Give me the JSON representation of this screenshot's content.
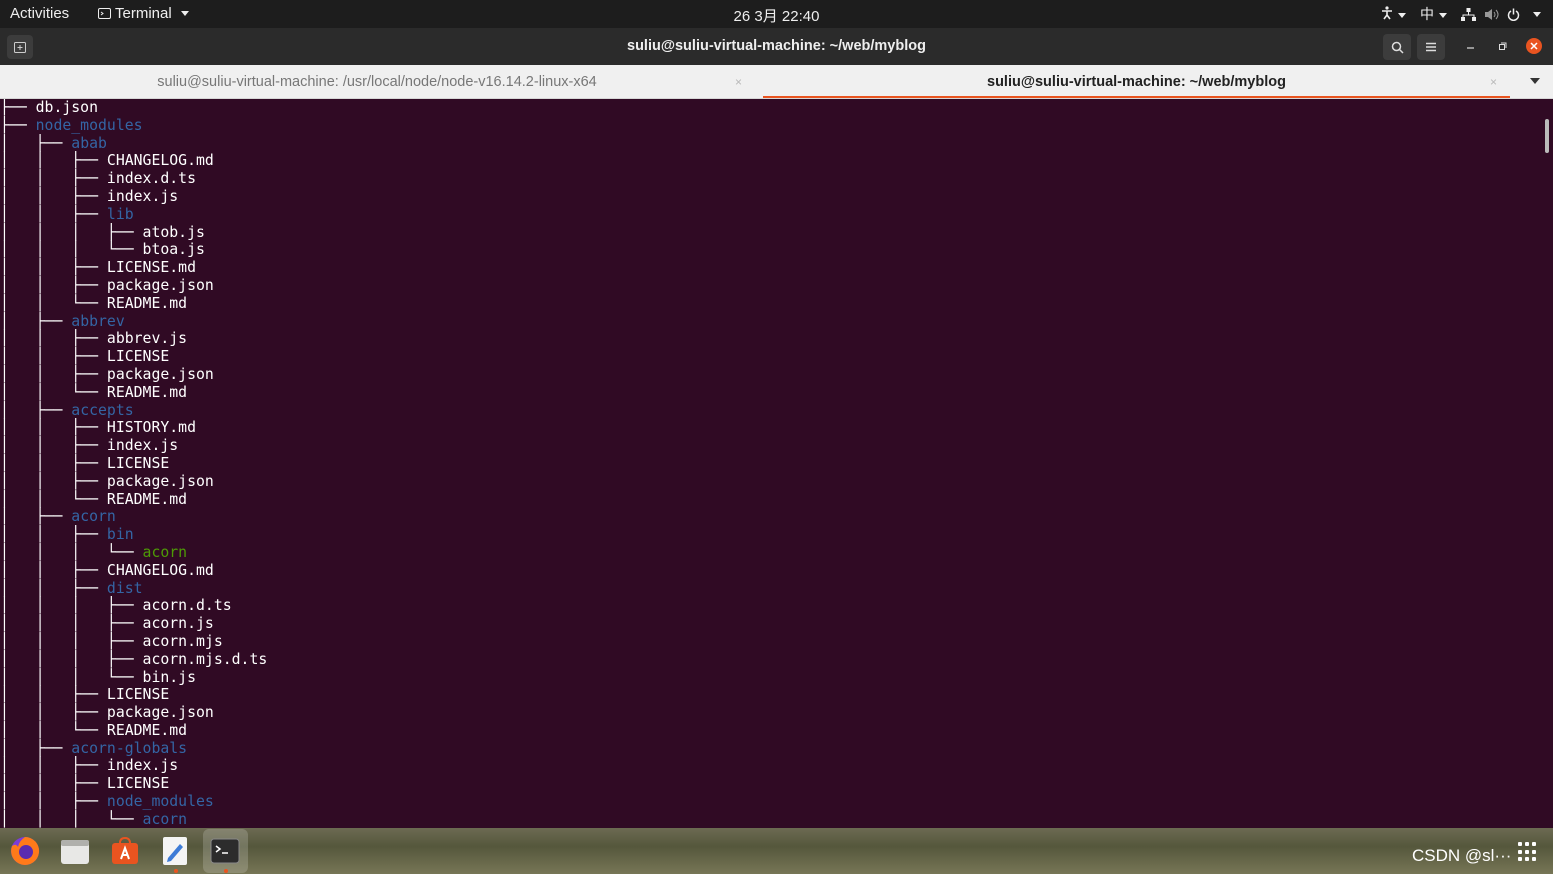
{
  "topbar": {
    "activities": "Activities",
    "app_name": "Terminal",
    "clock": "26 3月  22:40",
    "input_method": "中"
  },
  "window": {
    "title": "suliu@suliu-virtual-machine: ~/web/myblog",
    "tabs": [
      {
        "label": "suliu@suliu-virtual-machine: /usr/local/node/node-v16.14.2-linux-x64",
        "active": false
      },
      {
        "label": "suliu@suliu-virtual-machine: ~/web/myblog",
        "active": true
      }
    ],
    "close_glyph": "×"
  },
  "terminal": {
    "lines": [
      {
        "prefix": "├── ",
        "name": "db.json",
        "type": "file"
      },
      {
        "prefix": "├── ",
        "name": "node_modules",
        "type": "dir"
      },
      {
        "prefix": "│   ├── ",
        "name": "abab",
        "type": "dir"
      },
      {
        "prefix": "│   │   ├── ",
        "name": "CHANGELOG.md",
        "type": "file"
      },
      {
        "prefix": "│   │   ├── ",
        "name": "index.d.ts",
        "type": "file"
      },
      {
        "prefix": "│   │   ├── ",
        "name": "index.js",
        "type": "file"
      },
      {
        "prefix": "│   │   ├── ",
        "name": "lib",
        "type": "dir"
      },
      {
        "prefix": "│   │   │   ├── ",
        "name": "atob.js",
        "type": "file"
      },
      {
        "prefix": "│   │   │   └── ",
        "name": "btoa.js",
        "type": "file"
      },
      {
        "prefix": "│   │   ├── ",
        "name": "LICENSE.md",
        "type": "file"
      },
      {
        "prefix": "│   │   ├── ",
        "name": "package.json",
        "type": "file"
      },
      {
        "prefix": "│   │   └── ",
        "name": "README.md",
        "type": "file"
      },
      {
        "prefix": "│   ├── ",
        "name": "abbrev",
        "type": "dir"
      },
      {
        "prefix": "│   │   ├── ",
        "name": "abbrev.js",
        "type": "file"
      },
      {
        "prefix": "│   │   ├── ",
        "name": "LICENSE",
        "type": "file"
      },
      {
        "prefix": "│   │   ├── ",
        "name": "package.json",
        "type": "file"
      },
      {
        "prefix": "│   │   └── ",
        "name": "README.md",
        "type": "file"
      },
      {
        "prefix": "│   ├── ",
        "name": "accepts",
        "type": "dir"
      },
      {
        "prefix": "│   │   ├── ",
        "name": "HISTORY.md",
        "type": "file"
      },
      {
        "prefix": "│   │   ├── ",
        "name": "index.js",
        "type": "file"
      },
      {
        "prefix": "│   │   ├── ",
        "name": "LICENSE",
        "type": "file"
      },
      {
        "prefix": "│   │   ├── ",
        "name": "package.json",
        "type": "file"
      },
      {
        "prefix": "│   │   └── ",
        "name": "README.md",
        "type": "file"
      },
      {
        "prefix": "│   ├── ",
        "name": "acorn",
        "type": "dir"
      },
      {
        "prefix": "│   │   ├── ",
        "name": "bin",
        "type": "dir"
      },
      {
        "prefix": "│   │   │   └── ",
        "name": "acorn",
        "type": "exe"
      },
      {
        "prefix": "│   │   ├── ",
        "name": "CHANGELOG.md",
        "type": "file"
      },
      {
        "prefix": "│   │   ├── ",
        "name": "dist",
        "type": "dir"
      },
      {
        "prefix": "│   │   │   ├── ",
        "name": "acorn.d.ts",
        "type": "file"
      },
      {
        "prefix": "│   │   │   ├── ",
        "name": "acorn.js",
        "type": "file"
      },
      {
        "prefix": "│   │   │   ├── ",
        "name": "acorn.mjs",
        "type": "file"
      },
      {
        "prefix": "│   │   │   ├── ",
        "name": "acorn.mjs.d.ts",
        "type": "file"
      },
      {
        "prefix": "│   │   │   └── ",
        "name": "bin.js",
        "type": "file"
      },
      {
        "prefix": "│   │   ├── ",
        "name": "LICENSE",
        "type": "file"
      },
      {
        "prefix": "│   │   ├── ",
        "name": "package.json",
        "type": "file"
      },
      {
        "prefix": "│   │   └── ",
        "name": "README.md",
        "type": "file"
      },
      {
        "prefix": "│   ├── ",
        "name": "acorn-globals",
        "type": "dir"
      },
      {
        "prefix": "│   │   ├── ",
        "name": "index.js",
        "type": "file"
      },
      {
        "prefix": "│   │   ├── ",
        "name": "LICENSE",
        "type": "file"
      },
      {
        "prefix": "│   │   ├── ",
        "name": "node_modules",
        "type": "dir"
      },
      {
        "prefix": "│   │   │   └── ",
        "name": "acorn",
        "type": "dir"
      }
    ]
  },
  "dock": {
    "apps": [
      {
        "name": "firefox-icon"
      },
      {
        "name": "files-icon"
      },
      {
        "name": "software-center-icon"
      },
      {
        "name": "text-editor-icon"
      },
      {
        "name": "terminal-icon"
      }
    ],
    "watermark": "CSDN @sl···"
  },
  "colors": {
    "terminal_bg": "#300a24",
    "directory": "#3465a4",
    "executable": "#4e9a06",
    "accent": "#e95420"
  }
}
